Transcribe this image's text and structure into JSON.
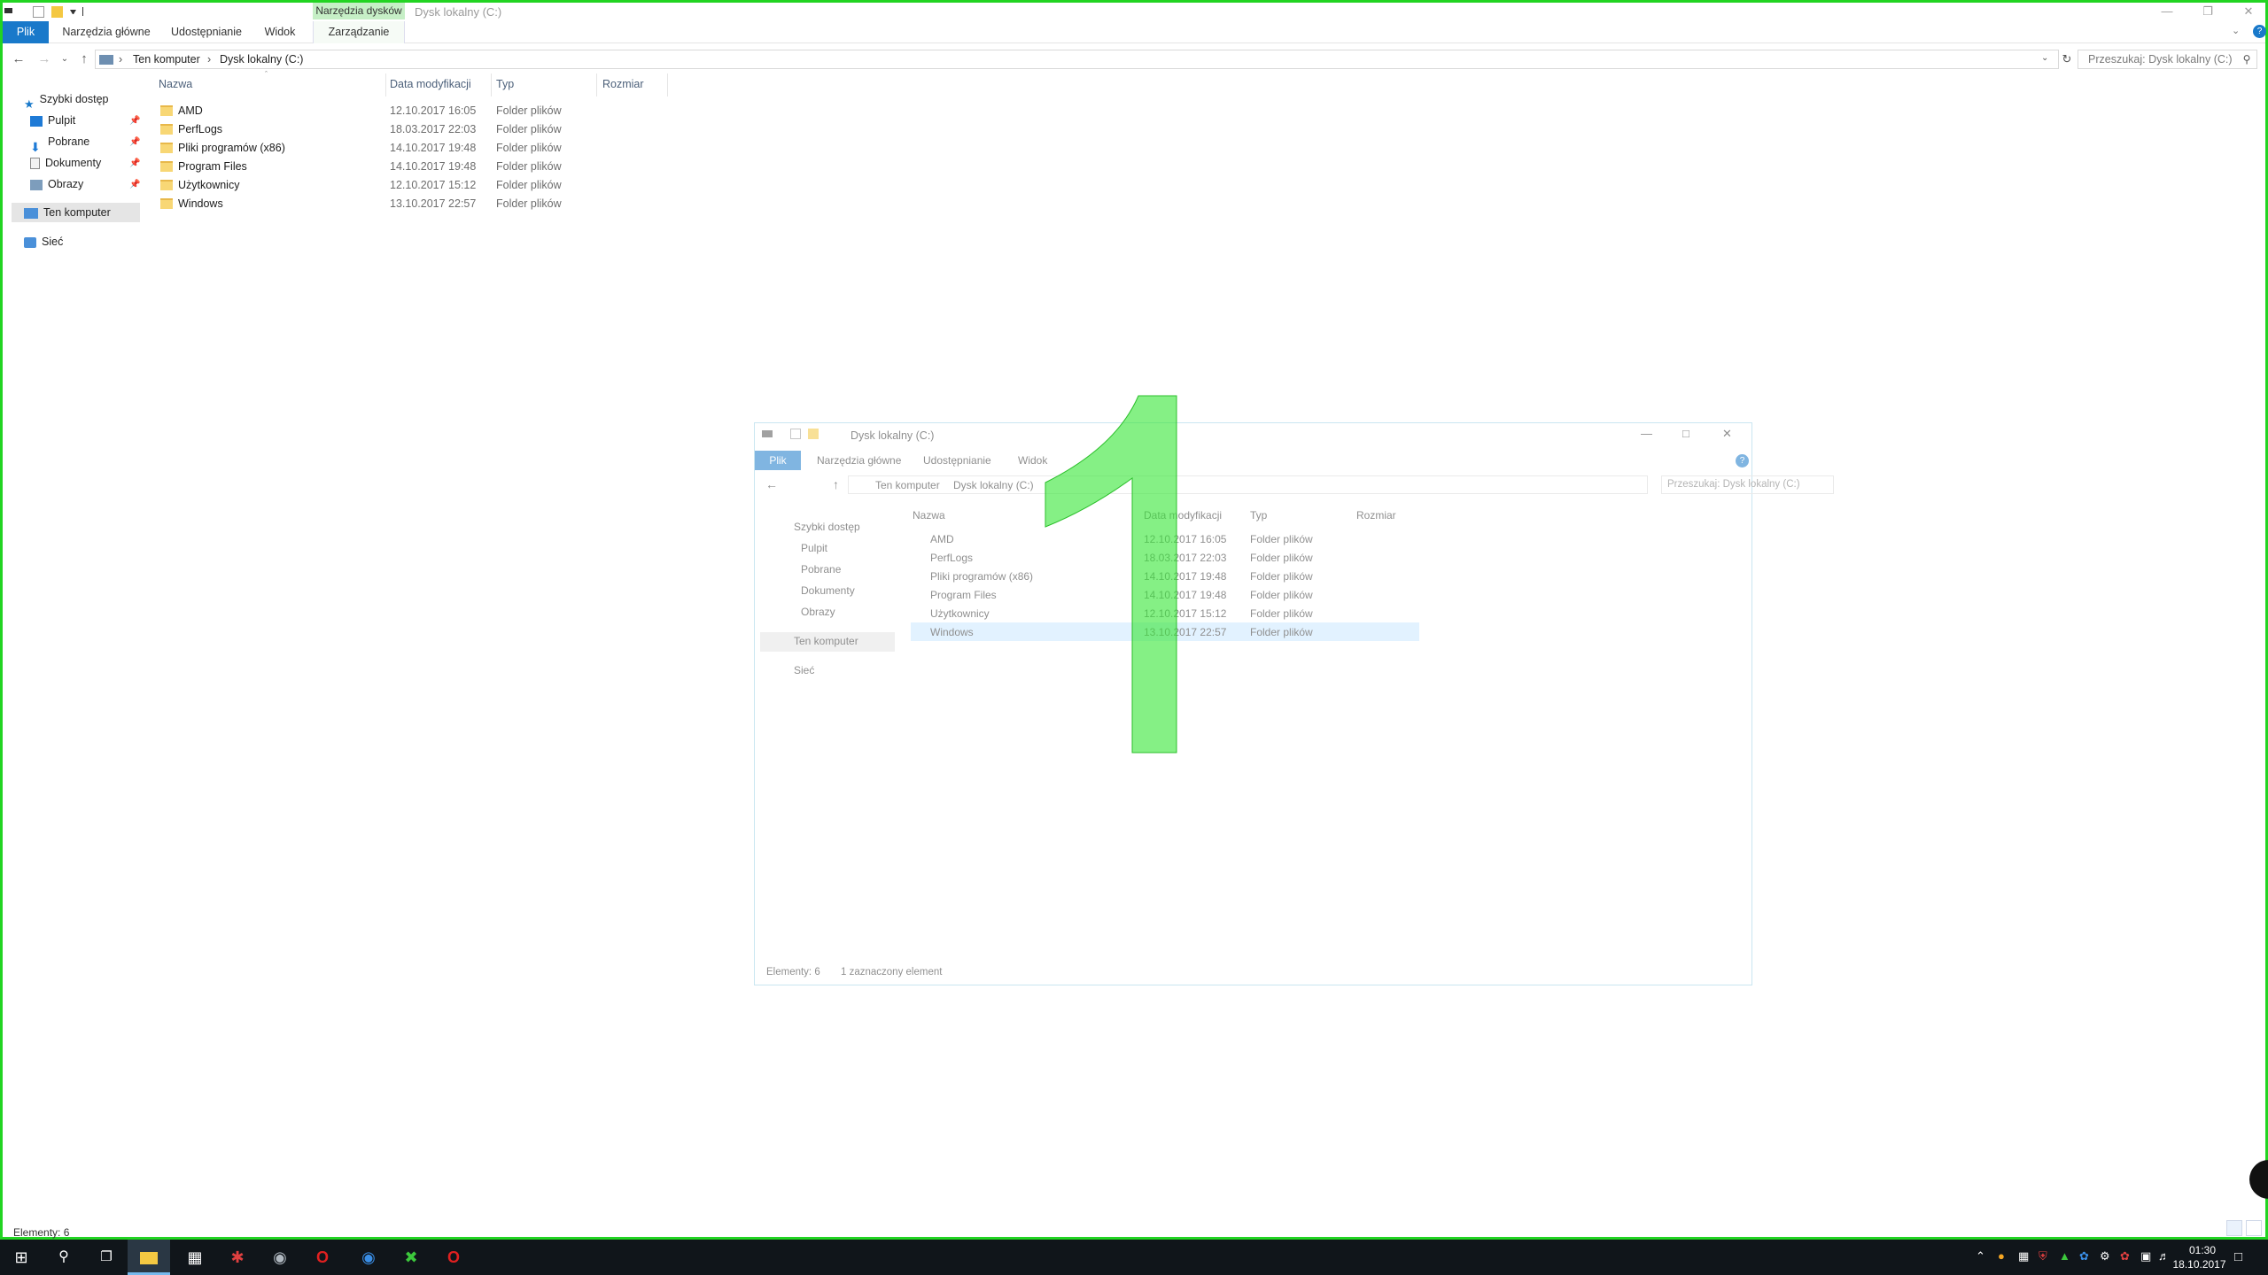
{
  "main": {
    "context_tab_header": "Narzędzia dysków",
    "title": "Dysk lokalny (C:)",
    "ribbon_tabs": [
      "Plik",
      "Narzędzia główne",
      "Udostępnianie",
      "Widok",
      "Zarządzanie"
    ],
    "breadcrumb": [
      "Ten komputer",
      "Dysk lokalny (C:)"
    ],
    "search_placeholder": "Przeszukaj: Dysk lokalny (C:)",
    "nav": {
      "quick_access": "Szybki dostęp",
      "items": [
        {
          "label": "Pulpit",
          "icon": "desktop-icon",
          "pinned": true
        },
        {
          "label": "Pobrane",
          "icon": "download-icon",
          "pinned": true
        },
        {
          "label": "Dokumenty",
          "icon": "document-icon",
          "pinned": true
        },
        {
          "label": "Obrazy",
          "icon": "pictures-icon",
          "pinned": true
        }
      ],
      "this_pc": "Ten komputer",
      "network": "Sieć"
    },
    "columns": [
      "Nazwa",
      "Data modyfikacji",
      "Typ",
      "Rozmiar"
    ],
    "files": [
      {
        "name": "AMD",
        "date": "12.10.2017 16:05",
        "type": "Folder plików"
      },
      {
        "name": "PerfLogs",
        "date": "18.03.2017 22:03",
        "type": "Folder plików"
      },
      {
        "name": "Pliki programów (x86)",
        "date": "14.10.2017 19:48",
        "type": "Folder plików"
      },
      {
        "name": "Program Files",
        "date": "14.10.2017 19:48",
        "type": "Folder plików"
      },
      {
        "name": "Użytkownicy",
        "date": "12.10.2017 15:12",
        "type": "Folder plików"
      },
      {
        "name": "Windows",
        "date": "13.10.2017 22:57",
        "type": "Folder plików"
      }
    ],
    "status": "Elementy: 6"
  },
  "float": {
    "title": "Dysk lokalny (C:)",
    "ribbon_tabs": [
      "Plik",
      "Narzędzia główne",
      "Udostępnianie",
      "Widok"
    ],
    "breadcrumb": [
      "Ten komputer",
      "Dysk lokalny (C:)"
    ],
    "search_placeholder": "Przeszukaj: Dysk lokalny (C:)",
    "status_count": "Elementy: 6",
    "status_selected": "1 zaznaczony element",
    "selected_file": "Windows"
  },
  "annotation": {
    "text": "1",
    "color": "#33e633"
  },
  "taskbar": {
    "apps": [
      "start-icon",
      "search-icon",
      "task-view-icon",
      "file-explorer-icon",
      "calendar-app-icon",
      "red-app-icon",
      "globe-app-icon",
      "opera-icon",
      "browser-icon",
      "green-app-icon",
      "opera-red-icon"
    ],
    "time": "01:30",
    "date": "18.10.2017"
  },
  "colors": {
    "accent": "#1979ca",
    "frame": "#22d422",
    "context_tab": "#c6efc6"
  }
}
